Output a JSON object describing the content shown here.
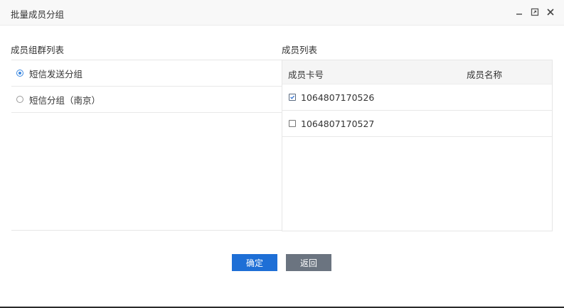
{
  "dialog": {
    "title": "批量成员分组",
    "controls": [
      "minimize-icon",
      "maximize-icon",
      "close-icon"
    ]
  },
  "left": {
    "label": "成员组群列表",
    "groups": [
      {
        "label": "短信发送分组",
        "selected": true
      },
      {
        "label": "短信分组（南京）",
        "selected": false
      }
    ]
  },
  "right": {
    "label": "成员列表",
    "columns": {
      "card": "成员卡号",
      "name": "成员名称"
    },
    "rows": [
      {
        "card": "1064807170526",
        "name": "",
        "checked": true
      },
      {
        "card": "1064807170527",
        "name": "",
        "checked": false
      }
    ]
  },
  "buttons": {
    "confirm": "确定",
    "back": "返回"
  },
  "colors": {
    "primary": "#1e6fd6",
    "secondary": "#6b7480",
    "radio_accent": "#3a87e0"
  }
}
